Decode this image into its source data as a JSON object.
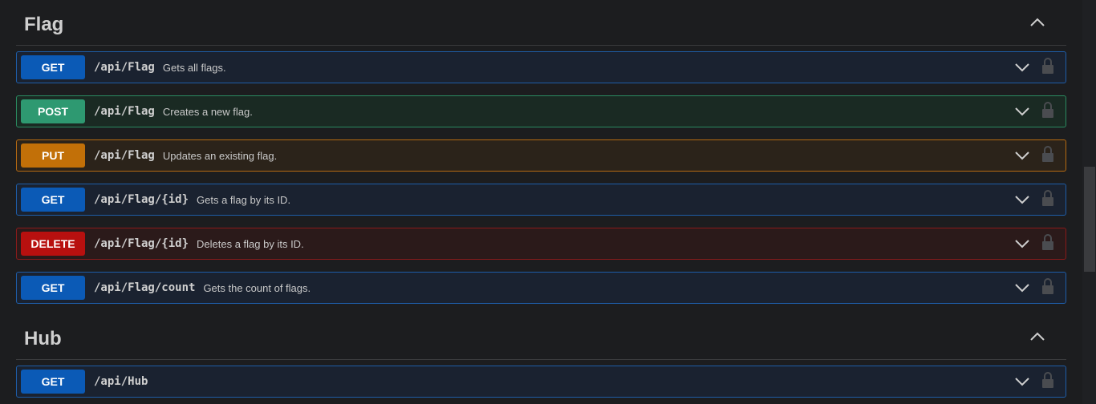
{
  "sections": [
    {
      "title": "Flag",
      "operations": [
        {
          "method": "GET",
          "path": "/api/Flag",
          "summary": "Gets all flags."
        },
        {
          "method": "POST",
          "path": "/api/Flag",
          "summary": "Creates a new flag."
        },
        {
          "method": "PUT",
          "path": "/api/Flag",
          "summary": "Updates an existing flag."
        },
        {
          "method": "GET",
          "path": "/api/Flag/{id}",
          "summary": "Gets a flag by its ID."
        },
        {
          "method": "DELETE",
          "path": "/api/Flag/{id}",
          "summary": "Deletes a flag by its ID."
        },
        {
          "method": "GET",
          "path": "/api/Flag/count",
          "summary": "Gets the count of flags."
        }
      ]
    },
    {
      "title": "Hub",
      "operations": [
        {
          "method": "GET",
          "path": "/api/Hub",
          "summary": ""
        }
      ]
    }
  ],
  "icons": {
    "section_toggle": "chevron-up-icon",
    "expand": "chevron-down-icon",
    "auth": "lock-icon"
  },
  "colors": {
    "get": "#0b5ab6",
    "post": "#2e9971",
    "put": "#c27008",
    "delete": "#b8100f"
  }
}
